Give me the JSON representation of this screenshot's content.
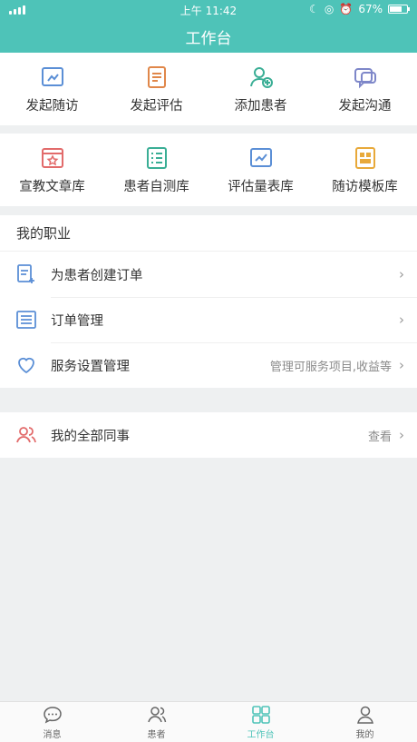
{
  "status": {
    "time": "上午 11:42",
    "battery": "67%"
  },
  "header": {
    "title": "工作台"
  },
  "quick_actions": [
    {
      "label": "发起随访",
      "icon": "follow-up-icon"
    },
    {
      "label": "发起评估",
      "icon": "assessment-icon"
    },
    {
      "label": "添加患者",
      "icon": "add-patient-icon"
    },
    {
      "label": "发起沟通",
      "icon": "chat-icon"
    }
  ],
  "libraries": [
    {
      "label": "宣教文章库",
      "icon": "article-library-icon"
    },
    {
      "label": "患者自测库",
      "icon": "self-test-icon"
    },
    {
      "label": "评估量表库",
      "icon": "scale-library-icon"
    },
    {
      "label": "随访模板库",
      "icon": "template-library-icon"
    }
  ],
  "profession": {
    "title": "我的职业",
    "items": [
      {
        "label": "为患者创建订单",
        "sub": "",
        "icon": "create-order-icon"
      },
      {
        "label": "订单管理",
        "sub": "",
        "icon": "order-list-icon"
      },
      {
        "label": "服务设置管理",
        "sub": "管理可服务项目,收益等",
        "icon": "heart-icon"
      }
    ]
  },
  "colleagues": {
    "label": "我的全部同事",
    "sub": "查看",
    "icon": "colleagues-icon"
  },
  "tabs": [
    {
      "label": "消息",
      "icon": "message-icon"
    },
    {
      "label": "患者",
      "icon": "patients-icon"
    },
    {
      "label": "工作台",
      "icon": "workbench-icon"
    },
    {
      "label": "我的",
      "icon": "profile-icon"
    }
  ],
  "colors": {
    "accent": "#4ec3b8",
    "background": "#eef0f1"
  }
}
